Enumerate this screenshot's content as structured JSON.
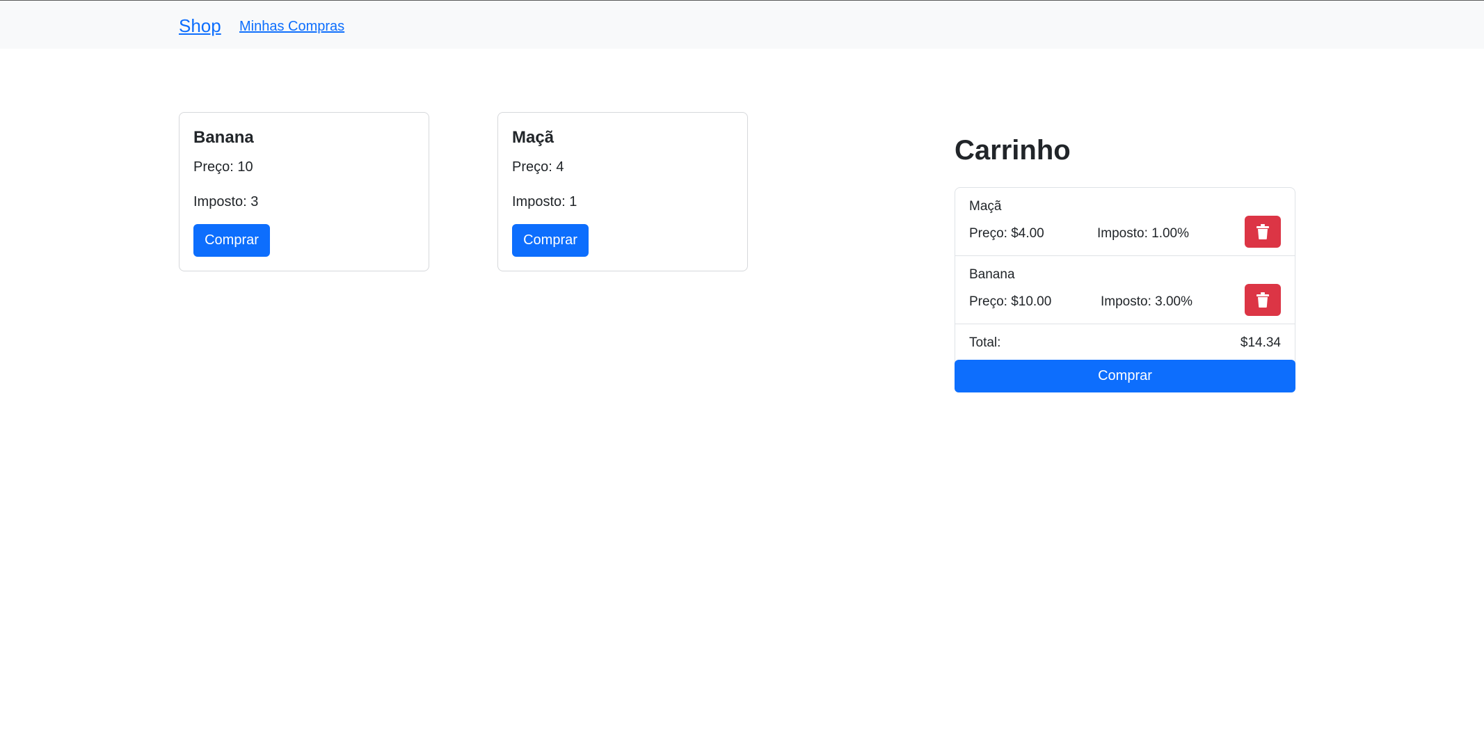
{
  "navbar": {
    "brand": "Shop",
    "link": "Minhas Compras"
  },
  "products": [
    {
      "name": "Banana",
      "price": "Preço: 10",
      "tax": "Imposto: 3",
      "button": "Comprar"
    },
    {
      "name": "Maçã",
      "price": "Preço: 4",
      "tax": "Imposto: 1",
      "button": "Comprar"
    }
  ],
  "cart": {
    "title": "Carrinho",
    "items": [
      {
        "name": "Maçã",
        "price": "Preço: $4.00",
        "tax": "Imposto: 1.00%",
        "remove_icon": "trash-icon"
      },
      {
        "name": "Banana",
        "price": "Preço: $10.00",
        "tax": "Imposto: 3.00%",
        "remove_icon": "trash-icon"
      }
    ],
    "total_label": "Total:",
    "total_value": "$14.34",
    "checkout_button": "Comprar"
  },
  "colors": {
    "primary": "#0d6efd",
    "danger": "#dc3545",
    "navbar_bg": "#f8f9fa"
  }
}
